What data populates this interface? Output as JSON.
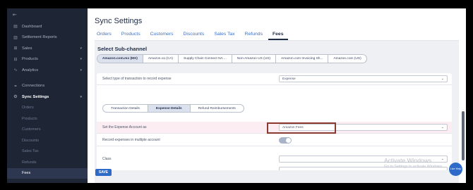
{
  "sidebar": {
    "top_icon": "⇤",
    "items": [
      {
        "label": "Dashboard",
        "icon": "dashboard-icon",
        "glyph": "▤"
      },
      {
        "label": "Settlement Reports",
        "icon": "reports-icon",
        "glyph": "▥"
      },
      {
        "label": "Sales",
        "icon": "sales-icon",
        "glyph": "⊞",
        "chevron": "▾"
      },
      {
        "label": "Products",
        "icon": "products-icon",
        "glyph": "⊟",
        "chevron": "▾"
      },
      {
        "label": "Analytics",
        "icon": "analytics-icon",
        "glyph": "∿",
        "chevron": "▾"
      },
      {
        "label": "Connections",
        "icon": "connections-icon",
        "glyph": "⚭"
      },
      {
        "label": "Sync Settings",
        "icon": "gear-icon",
        "glyph": "⚙",
        "chevron": "▾"
      }
    ],
    "sub_items": [
      "Orders",
      "Products",
      "Customers",
      "Discounts",
      "Sales Tax",
      "Refunds",
      "Fees"
    ]
  },
  "header": {
    "title": "Sync Settings",
    "tabs": [
      "Orders",
      "Products",
      "Customers",
      "Discounts",
      "Sales Tax",
      "Refunds",
      "Fees"
    ],
    "active_tab": "Fees"
  },
  "subchannel": {
    "title": "Select Sub-channel",
    "channels": [
      "Amazon.com.mx (MX)",
      "Amazon.ca (CA)",
      "Supply Chain Connect NA ...",
      "Non-Amazon US (US)",
      "Amazon.com Invoicing Sh...",
      "Amazon.com (US)"
    ],
    "active": "Amazon.com.mx (MX)"
  },
  "form": {
    "transaction_type_label": "Select type of transaction to record expense",
    "transaction_type_value": "Expense",
    "inner_tabs": [
      "Transaction Details",
      "Expense Details",
      "Refund Reimbursements"
    ],
    "active_inner_tab": "Expense Details",
    "expense_account_label": "Set the Expense Account as",
    "expense_account_value": "Amazon Fees",
    "multiple_label": "Record expenses in multiple account",
    "multiple_enabled": false,
    "class_label": "Class",
    "class_value": ""
  },
  "footer": {
    "save_label": "SAVE"
  },
  "watermark": {
    "line1": "Activate Windows",
    "line2": "Go to Settings to activate Windows."
  },
  "live_help": "Live Help",
  "colors": {
    "sidebar_bg": "#1e2636",
    "accent": "#2e6bc9",
    "highlight_row": "#fbedf1",
    "red_box": "#8b3a2f"
  }
}
